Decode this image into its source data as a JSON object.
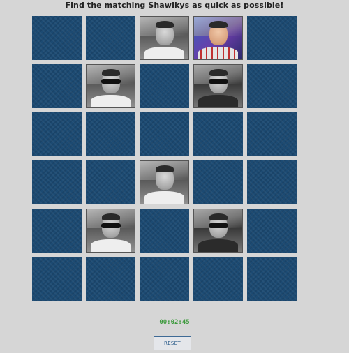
{
  "header": {
    "title": "Find the matching Shawlkys as quick as possible!"
  },
  "board": {
    "rows": 6,
    "columns": 5,
    "card_back_color": "#1c4a72",
    "cards": [
      {
        "state": "hidden"
      },
      {
        "state": "hidden"
      },
      {
        "state": "revealed",
        "photo": "bw-portrait-plain-shirt"
      },
      {
        "state": "revealed",
        "photo": "color-portrait-patterned-shirt"
      },
      {
        "state": "hidden"
      },
      {
        "state": "hidden"
      },
      {
        "state": "revealed",
        "photo": "bw-portrait-sunglasses-white-shirt"
      },
      {
        "state": "hidden"
      },
      {
        "state": "revealed",
        "photo": "bw-portrait-sunglasses-dark-shirt"
      },
      {
        "state": "hidden"
      },
      {
        "state": "hidden"
      },
      {
        "state": "hidden"
      },
      {
        "state": "hidden"
      },
      {
        "state": "hidden"
      },
      {
        "state": "hidden"
      },
      {
        "state": "hidden"
      },
      {
        "state": "hidden"
      },
      {
        "state": "revealed",
        "photo": "bw-portrait-plain-shirt"
      },
      {
        "state": "hidden"
      },
      {
        "state": "hidden"
      },
      {
        "state": "hidden"
      },
      {
        "state": "revealed",
        "photo": "bw-portrait-sunglasses-white-shirt"
      },
      {
        "state": "hidden"
      },
      {
        "state": "revealed",
        "photo": "bw-portrait-sunglasses-dark-shirt"
      },
      {
        "state": "hidden"
      },
      {
        "state": "hidden"
      },
      {
        "state": "hidden"
      },
      {
        "state": "hidden"
      },
      {
        "state": "hidden"
      },
      {
        "state": "hidden"
      }
    ]
  },
  "timer": {
    "value": "00:02:45",
    "color": "#3d9a3d"
  },
  "controls": {
    "reset_label": "RESET"
  }
}
